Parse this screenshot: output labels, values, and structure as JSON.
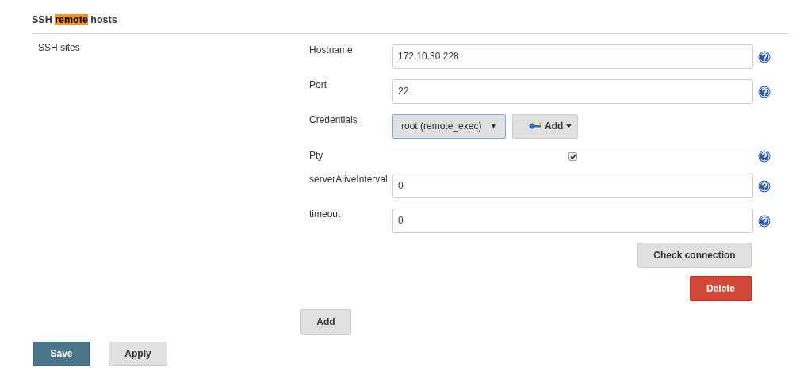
{
  "section": {
    "title": "SSH **remote** hosts",
    "subtitle": "SSH sites"
  },
  "fields": [
    {
      "kind": "text",
      "label": "Hostname",
      "value": "172.10.30.228"
    },
    {
      "kind": "text",
      "label": "Port",
      "value": "22"
    },
    {
      "kind": "select",
      "label": "Credentials",
      "value": "root (remote_exec)",
      "arrow": "▼",
      "add_label": "Add"
    },
    {
      "kind": "checkbox",
      "label": "Pty",
      "checked": true
    },
    {
      "kind": "text",
      "label": "serverAliveInterval",
      "value": "0"
    },
    {
      "kind": "text",
      "label": "timeout",
      "value": "0"
    }
  ],
  "check_button": "Check connection",
  "delete_button": "Delete",
  "add_button": "Add",
  "footer_buttons": [
    {
      "label": "Save",
      "primary": true
    },
    {
      "label": "Apply",
      "primary": false
    }
  ]
}
